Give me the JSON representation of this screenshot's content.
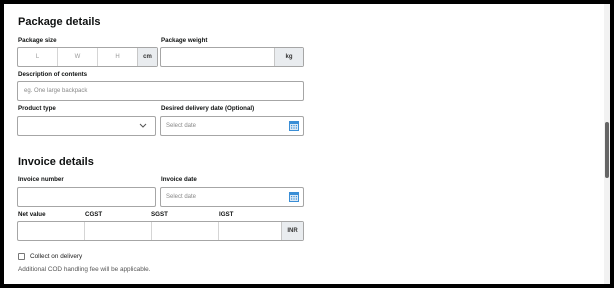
{
  "package": {
    "title": "Package details",
    "size_label": "Package size",
    "size_l": "L",
    "size_w": "W",
    "size_h": "H",
    "size_unit": "cm",
    "weight_label": "Package weight",
    "weight_unit": "kg",
    "desc_label": "Description of contents",
    "desc_placeholder": "eg. One large backpack",
    "product_type_label": "Product type",
    "delivery_date_label": "Desired delivery date (Optional)",
    "delivery_date_placeholder": "Select date"
  },
  "invoice": {
    "title": "Invoice details",
    "number_label": "Invoice number",
    "date_label": "Invoice date",
    "date_placeholder": "Select date",
    "net_label": "Net value",
    "cgst_label": "CGST",
    "sgst_label": "SGST",
    "igst_label": "IGST",
    "currency": "INR",
    "cod_label": "Collect on delivery",
    "cod_note": "Additional COD handling fee will be applicable."
  },
  "icons": {
    "calendar": "calendar-icon",
    "chevron": "chevron-down-icon"
  },
  "colors": {
    "calendar_blue": "#3a8ed6",
    "unit_bg": "#e9ecef",
    "border": "#a6a6a6"
  }
}
